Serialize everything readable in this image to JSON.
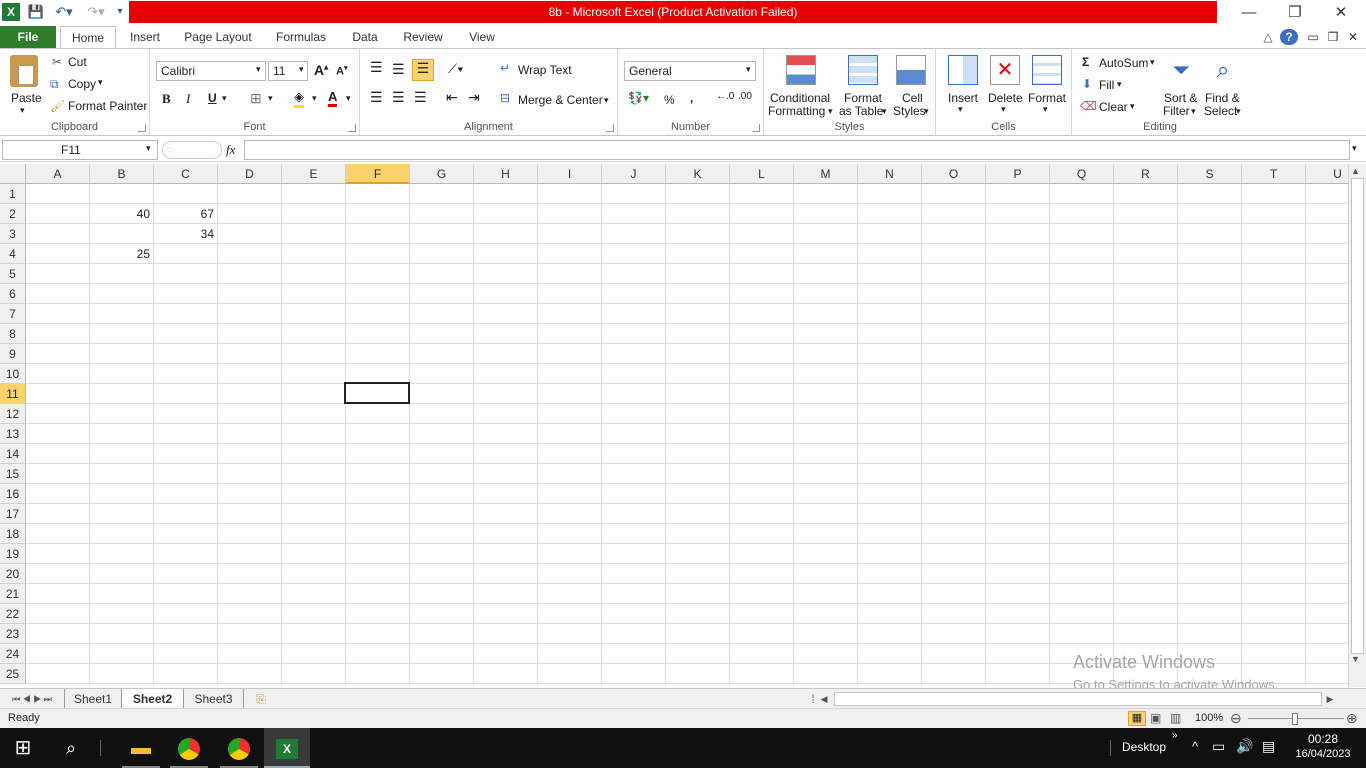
{
  "window": {
    "title": "8b  -  Microsoft Excel (Product Activation Failed)",
    "minimize": "—",
    "restore": "❐",
    "close": "✕"
  },
  "quick_access": {
    "save_icon": "floppy-icon",
    "undo_icon": "undo-icon",
    "redo_icon": "redo-icon"
  },
  "tabs": {
    "file": "File",
    "items": [
      "Home",
      "Insert",
      "Page Layout",
      "Formulas",
      "Data",
      "Review",
      "View"
    ]
  },
  "ribbon": {
    "clipboard": {
      "label": "Clipboard",
      "paste": "Paste",
      "cut": "Cut",
      "copy": "Copy",
      "format_painter": "Format Painter"
    },
    "font": {
      "label": "Font",
      "name": "Calibri",
      "size": "11",
      "bold": "B",
      "italic": "I",
      "underline": "U"
    },
    "alignment": {
      "label": "Alignment",
      "wrap_text": "Wrap Text",
      "merge_center": "Merge & Center"
    },
    "number": {
      "label": "Number",
      "format": "General",
      "percent": "%",
      "comma": ","
    },
    "styles": {
      "label": "Styles",
      "conditional": "Conditional",
      "formatting": "Formatting",
      "format_as": "Format",
      "as_table": "as Table",
      "cell": "Cell",
      "styles_btn": "Styles"
    },
    "cells": {
      "label": "Cells",
      "insert": "Insert",
      "delete": "Delete",
      "format": "Format"
    },
    "editing": {
      "label": "Editing",
      "autosum": "AutoSum",
      "fill": "Fill",
      "clear": "Clear",
      "sort": "Sort &",
      "filter": "Filter",
      "find": "Find &",
      "select": "Select"
    }
  },
  "formula_bar": {
    "name_box": "F11",
    "fx": "fx",
    "value": ""
  },
  "grid": {
    "columns": [
      "A",
      "B",
      "C",
      "D",
      "E",
      "F",
      "G",
      "H",
      "I",
      "J",
      "K",
      "L",
      "M",
      "N",
      "O",
      "P",
      "Q",
      "R",
      "S",
      "T",
      "U"
    ],
    "rows": [
      "1",
      "2",
      "3",
      "4",
      "5",
      "6",
      "7",
      "8",
      "9",
      "10",
      "11",
      "12",
      "13",
      "14",
      "15",
      "16",
      "17",
      "18",
      "19",
      "20",
      "21",
      "22",
      "23",
      "24",
      "25"
    ],
    "selected_column": "F",
    "selected_row": "11",
    "cells": [
      {
        "ref": "B2",
        "value": "40"
      },
      {
        "ref": "C2",
        "value": "67"
      },
      {
        "ref": "C3",
        "value": "34"
      },
      {
        "ref": "B4",
        "value": "25"
      }
    ]
  },
  "sheets": {
    "items": [
      "Sheet1",
      "Sheet2",
      "Sheet3"
    ],
    "active": "Sheet2"
  },
  "status": {
    "ready": "Ready",
    "zoom": "100%"
  },
  "watermark": {
    "line1": "Activate Windows",
    "line2": "Go to Settings to activate Windows."
  },
  "taskbar": {
    "desktop": "Desktop",
    "time": "00:28",
    "date": "16/04/2023"
  }
}
